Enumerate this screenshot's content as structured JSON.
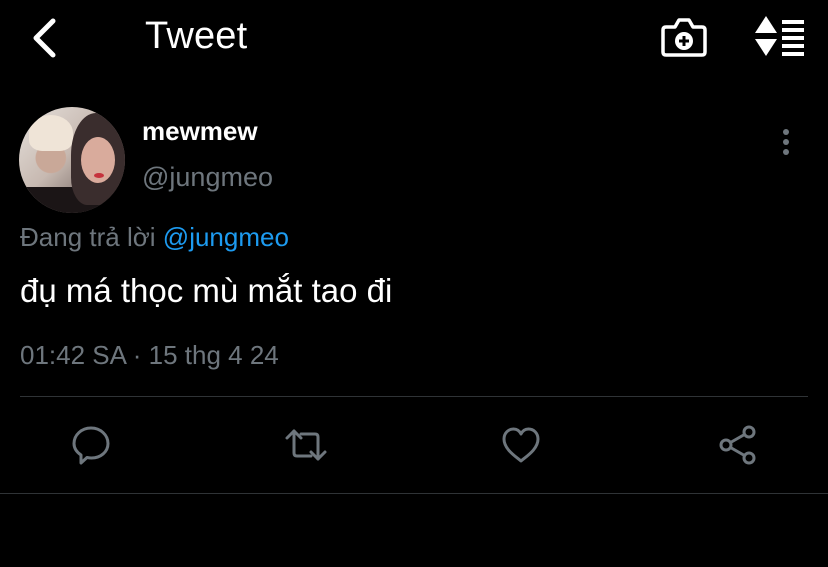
{
  "header": {
    "title": "Tweet",
    "back_icon": "chevron-left-icon",
    "camera_icon": "camera-plus-icon",
    "sort_icon": "sort-list-icon"
  },
  "author": {
    "display_name": "mewmew",
    "handle": "@jungmeo"
  },
  "tweet": {
    "reply_prefix": "Đang trả lời",
    "reply_to": "@jungmeo",
    "text": "đụ má thọc mù mắt tao đi",
    "timestamp": "01:42 SA · 15 thg 4 24"
  },
  "actions": [
    "reply-icon",
    "retweet-icon",
    "like-icon",
    "share-icon"
  ],
  "colors": {
    "background": "#000000",
    "text": "#ffffff",
    "secondary": "#6e767d",
    "link": "#1d9bf0",
    "divider": "#2f3336"
  }
}
